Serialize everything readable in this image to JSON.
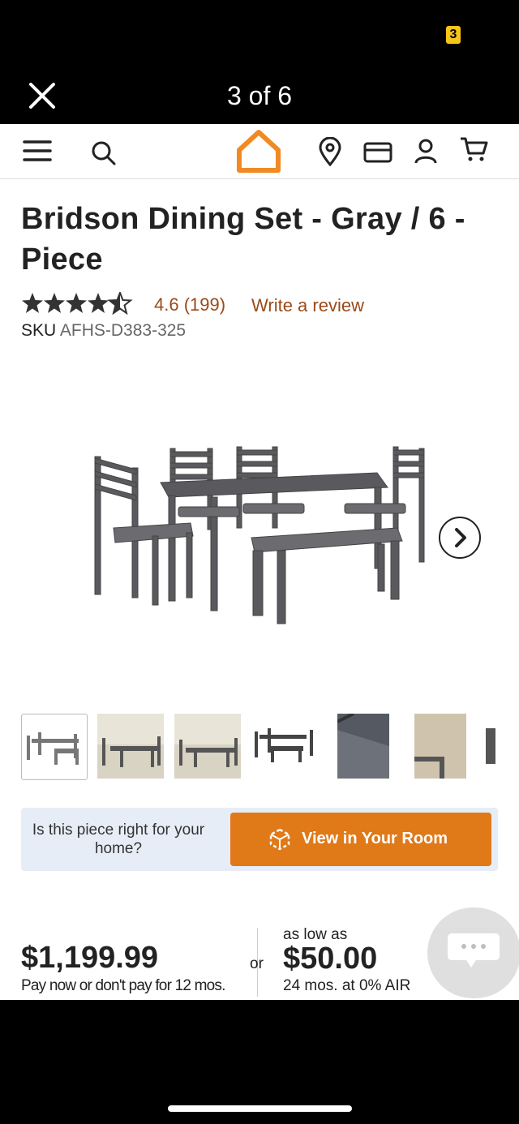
{
  "overlay": {
    "counter": "3 of 6",
    "status_badge": "3"
  },
  "header": {
    "icons": [
      "menu-icon",
      "search-icon",
      "home-logo-icon",
      "location-icon",
      "card-icon",
      "account-icon",
      "cart-icon"
    ]
  },
  "product": {
    "title": "Bridson Dining Set - Gray / 6 - Piece",
    "rating": "4.6",
    "review_count": "(199)",
    "write_review": "Write a review",
    "sku_label": "SKU",
    "sku_value": "AFHS-D383-325",
    "stars": 4.6
  },
  "gallery": {
    "thumbnail_count": 7,
    "selected_index": 0
  },
  "room": {
    "question": "Is this piece right for your home?",
    "button_label": "View in Your Room"
  },
  "pricing": {
    "price": "$1,199.99",
    "price_sub": "Pay now or don't pay for 12 mos.",
    "or": "or",
    "as_low_as": "as low as",
    "finance_price": "$50.00",
    "finance_sub": "24 mos. at 0% AIR"
  },
  "colors": {
    "accent": "#e07918",
    "link": "#9a4a1a",
    "room_bg": "#e6edf7"
  }
}
